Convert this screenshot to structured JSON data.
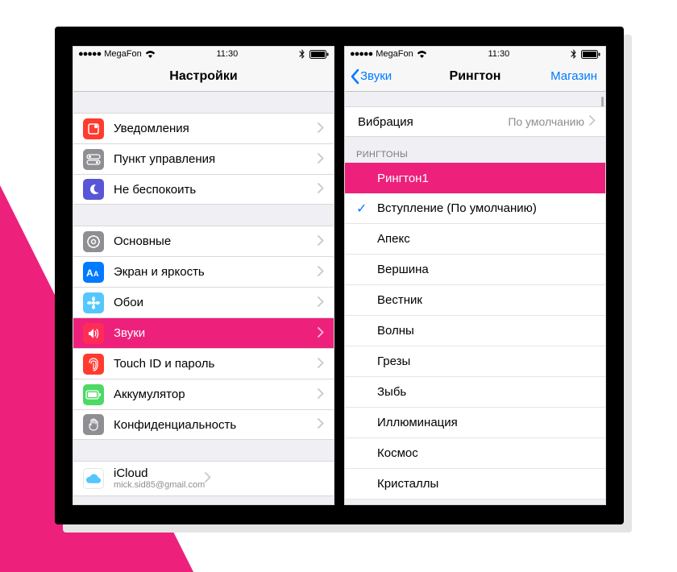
{
  "status": {
    "carrier": "MegaFon",
    "dots": "●●●●●",
    "time": "11:30"
  },
  "left": {
    "title": "Настройки",
    "group1": [
      {
        "label": "Уведомления",
        "iconColor": "#ff3b30",
        "iconName": "notifications-icon",
        "svg": "bell"
      },
      {
        "label": "Пункт управления",
        "iconColor": "#8e8e93",
        "iconName": "control-center-icon",
        "svg": "switch"
      },
      {
        "label": "Не беспокоить",
        "iconColor": "#5856d6",
        "iconName": "do-not-disturb-icon",
        "svg": "moon"
      }
    ],
    "group2": [
      {
        "label": "Основные",
        "iconColor": "#8e8e93",
        "iconName": "general-icon",
        "svg": "gear",
        "highlight": false
      },
      {
        "label": "Экран и яркость",
        "iconColor": "#007aff",
        "iconName": "display-icon",
        "svg": "aa",
        "highlight": false
      },
      {
        "label": "Обои",
        "iconColor": "#54c7fc",
        "iconName": "wallpaper-icon",
        "svg": "flower",
        "highlight": false
      },
      {
        "label": "Звуки",
        "iconColor": "#ff2d55",
        "iconName": "sounds-icon",
        "svg": "speaker",
        "highlight": true
      },
      {
        "label": "Touch ID и пароль",
        "iconColor": "#ff3b30",
        "iconName": "touchid-icon",
        "svg": "fingerprint",
        "highlight": false
      },
      {
        "label": "Аккумулятор",
        "iconColor": "#4cd964",
        "iconName": "battery-icon",
        "svg": "battery",
        "highlight": false
      },
      {
        "label": "Конфиденциальность",
        "iconColor": "#8e8e93",
        "iconName": "privacy-icon",
        "svg": "hand",
        "highlight": false
      }
    ],
    "icloud": {
      "label": "iCloud",
      "sub": "mick.sid85@gmail.com",
      "iconColor": "#ffffff",
      "iconName": "icloud-icon"
    }
  },
  "right": {
    "back": "Звуки",
    "title": "Рингтон",
    "store": "Магазин",
    "vibration": {
      "label": "Вибрация",
      "value": "По умолчанию"
    },
    "sectionHeader": "РИНГТОНЫ",
    "ringtones": [
      {
        "label": "Рингтон1",
        "highlight": true,
        "checked": false
      },
      {
        "label": "Вступление (По умолчанию)",
        "highlight": false,
        "checked": true
      },
      {
        "label": "Апекс",
        "highlight": false,
        "checked": false
      },
      {
        "label": "Вершина",
        "highlight": false,
        "checked": false
      },
      {
        "label": "Вестник",
        "highlight": false,
        "checked": false
      },
      {
        "label": "Волны",
        "highlight": false,
        "checked": false
      },
      {
        "label": "Грезы",
        "highlight": false,
        "checked": false
      },
      {
        "label": "Зыбь",
        "highlight": false,
        "checked": false
      },
      {
        "label": "Иллюминация",
        "highlight": false,
        "checked": false
      },
      {
        "label": "Космос",
        "highlight": false,
        "checked": false
      },
      {
        "label": "Кристаллы",
        "highlight": false,
        "checked": false
      }
    ]
  }
}
